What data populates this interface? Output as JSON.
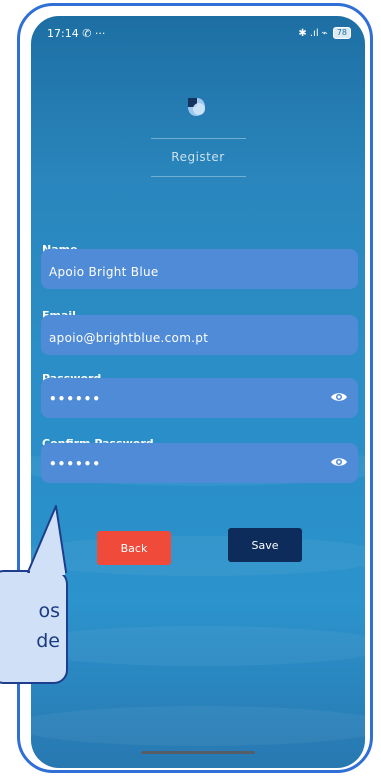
{
  "status_bar": {
    "time": "17:14",
    "left_icons": "✆ ···",
    "right_icons": "✱ .ıl ⌁",
    "battery": "78"
  },
  "header": {
    "title": "Register"
  },
  "form": {
    "name": {
      "label": "Name",
      "value": "Apoio Bright Blue"
    },
    "email": {
      "label": "Email",
      "value": "apoio@brightblue.com.pt"
    },
    "password": {
      "label": "Password",
      "value": "••••••"
    },
    "confirm_password": {
      "label": "Confirm Password",
      "value": "••••••"
    }
  },
  "buttons": {
    "back": "Back",
    "save": "Save"
  },
  "callout": {
    "line1": "os",
    "line2": "de"
  },
  "colors": {
    "back_button": "#f04a3a",
    "save_button": "#0d2c5c",
    "field_bg": "#4f8bd6",
    "phone_frame": "#2f6fd6",
    "callout_bg": "#cfe0f7",
    "callout_border": "#1d3e8c"
  },
  "icons": {
    "logo": "app-logo-icon",
    "password_toggle": "eye-icon",
    "confirm_password_toggle": "eye-icon"
  }
}
